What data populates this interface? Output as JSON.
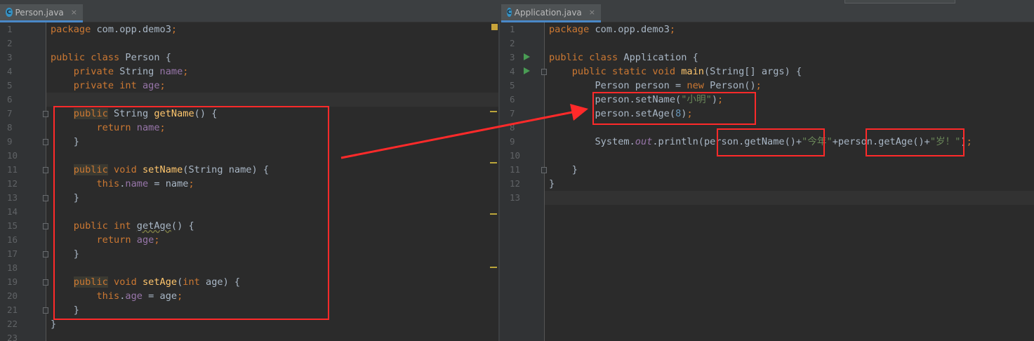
{
  "left_editor": {
    "tab": {
      "icon_letter": "C",
      "label": "Person.java"
    },
    "lines": [
      {
        "n": "1",
        "segs": [
          [
            "kw",
            "package "
          ],
          [
            "",
            "com.opp.demo3"
          ],
          [
            "kw",
            ";"
          ]
        ]
      },
      {
        "n": "2",
        "segs": []
      },
      {
        "n": "3",
        "segs": [
          [
            "kw",
            "public class "
          ],
          [
            "",
            "Person {"
          ]
        ]
      },
      {
        "n": "4",
        "segs": [
          [
            "",
            "    "
          ],
          [
            "kw",
            "private "
          ],
          [
            "",
            "String "
          ],
          [
            "fld",
            "name"
          ],
          [
            "kw",
            ";"
          ]
        ]
      },
      {
        "n": "5",
        "segs": [
          [
            "",
            "    "
          ],
          [
            "kw",
            "private int "
          ],
          [
            "fld",
            "age"
          ],
          [
            "kw",
            ";"
          ]
        ]
      },
      {
        "n": "6",
        "segs": []
      },
      {
        "n": "7",
        "segs": [
          [
            "",
            "    "
          ],
          [
            "kw hl-ann",
            "public"
          ],
          [
            "",
            " String "
          ],
          [
            "fn",
            "getName"
          ],
          [
            "",
            "() {"
          ]
        ]
      },
      {
        "n": "8",
        "segs": [
          [
            "",
            "        "
          ],
          [
            "kw",
            "return "
          ],
          [
            "fld",
            "name"
          ],
          [
            "kw",
            ";"
          ]
        ]
      },
      {
        "n": "9",
        "segs": [
          [
            "",
            "    }"
          ]
        ]
      },
      {
        "n": "10",
        "segs": []
      },
      {
        "n": "11",
        "segs": [
          [
            "",
            "    "
          ],
          [
            "kw hl-ann",
            "public"
          ],
          [
            "kw",
            " void "
          ],
          [
            "fn",
            "setName"
          ],
          [
            "",
            "(String name) {"
          ]
        ]
      },
      {
        "n": "12",
        "segs": [
          [
            "",
            "        "
          ],
          [
            "kw",
            "this"
          ],
          [
            "",
            "."
          ],
          [
            "fld",
            "name"
          ],
          [
            "",
            " = name"
          ],
          [
            "kw",
            ";"
          ]
        ]
      },
      {
        "n": "13",
        "segs": [
          [
            "",
            "    }"
          ]
        ]
      },
      {
        "n": "14",
        "segs": []
      },
      {
        "n": "15",
        "segs": [
          [
            "",
            "    "
          ],
          [
            "kw",
            "public int "
          ],
          [
            "warn",
            "getAge"
          ],
          [
            "",
            "() {"
          ]
        ]
      },
      {
        "n": "16",
        "segs": [
          [
            "",
            "        "
          ],
          [
            "kw",
            "return "
          ],
          [
            "fld",
            "age"
          ],
          [
            "kw",
            ";"
          ]
        ]
      },
      {
        "n": "17",
        "segs": [
          [
            "",
            "    }"
          ]
        ]
      },
      {
        "n": "18",
        "segs": []
      },
      {
        "n": "19",
        "segs": [
          [
            "",
            "    "
          ],
          [
            "kw hl-ann",
            "public"
          ],
          [
            "kw",
            " void "
          ],
          [
            "fn",
            "setAge"
          ],
          [
            "",
            "("
          ],
          [
            "kw",
            "int "
          ],
          [
            "",
            "age) {"
          ]
        ]
      },
      {
        "n": "20",
        "segs": [
          [
            "",
            "        "
          ],
          [
            "kw",
            "this"
          ],
          [
            "",
            "."
          ],
          [
            "fld",
            "age"
          ],
          [
            "",
            " = age"
          ],
          [
            "kw",
            ";"
          ]
        ]
      },
      {
        "n": "21",
        "segs": [
          [
            "",
            "    }"
          ]
        ]
      },
      {
        "n": "22",
        "segs": [
          [
            "",
            "}"
          ]
        ]
      },
      {
        "n": "23",
        "segs": []
      }
    ]
  },
  "right_editor": {
    "tab": {
      "icon_letter": "C",
      "label": "Application.java"
    },
    "lines": [
      {
        "n": "1",
        "segs": [
          [
            "kw",
            "package "
          ],
          [
            "",
            "com.opp.demo3"
          ],
          [
            "kw",
            ";"
          ]
        ]
      },
      {
        "n": "2",
        "segs": []
      },
      {
        "n": "3",
        "segs": [
          [
            "kw",
            "public class "
          ],
          [
            "",
            "Application {"
          ]
        ]
      },
      {
        "n": "4",
        "segs": [
          [
            "",
            "    "
          ],
          [
            "kw",
            "public static void "
          ],
          [
            "fn",
            "main"
          ],
          [
            "",
            "(String[] args) {"
          ]
        ]
      },
      {
        "n": "5",
        "segs": [
          [
            "",
            "        Person person = "
          ],
          [
            "kw",
            "new "
          ],
          [
            "",
            "Person()"
          ],
          [
            "kw",
            ";"
          ]
        ]
      },
      {
        "n": "6",
        "segs": [
          [
            "",
            "        person.setName("
          ],
          [
            "str",
            "\"小明\""
          ],
          [
            "",
            ")"
          ],
          [
            "kw",
            ";"
          ]
        ]
      },
      {
        "n": "7",
        "segs": [
          [
            "",
            "        person.setAge("
          ],
          [
            "num",
            "8"
          ],
          [
            "",
            ")"
          ],
          [
            "kw",
            ";"
          ]
        ]
      },
      {
        "n": "8",
        "segs": []
      },
      {
        "n": "9",
        "segs": [
          [
            "",
            "        System."
          ],
          [
            "stat",
            "out"
          ],
          [
            "",
            ".println(person.getName()+"
          ],
          [
            "str",
            "\"今年\""
          ],
          [
            "",
            "+person.getAge()+"
          ],
          [
            "str",
            "\"岁！\""
          ],
          [
            "",
            ")"
          ],
          [
            "kw",
            ";"
          ]
        ]
      },
      {
        "n": "10",
        "segs": []
      },
      {
        "n": "11",
        "segs": [
          [
            "",
            "    }"
          ]
        ]
      },
      {
        "n": "12",
        "segs": [
          [
            "",
            "}"
          ]
        ]
      },
      {
        "n": "13",
        "segs": []
      }
    ]
  },
  "colors": {
    "background": "#2b2b2b",
    "keyword": "#cc7832",
    "field": "#9876aa",
    "method": "#ffc66d",
    "string": "#6a8759",
    "number": "#6897bb",
    "annotation_box": "#ff2a2a"
  },
  "icons": {
    "tab_file": "java-class-icon",
    "tab_close": "close-icon",
    "run_gutter": "run-arrow-icon",
    "fold": "fold-marker-icon"
  },
  "close_glyph": "×"
}
